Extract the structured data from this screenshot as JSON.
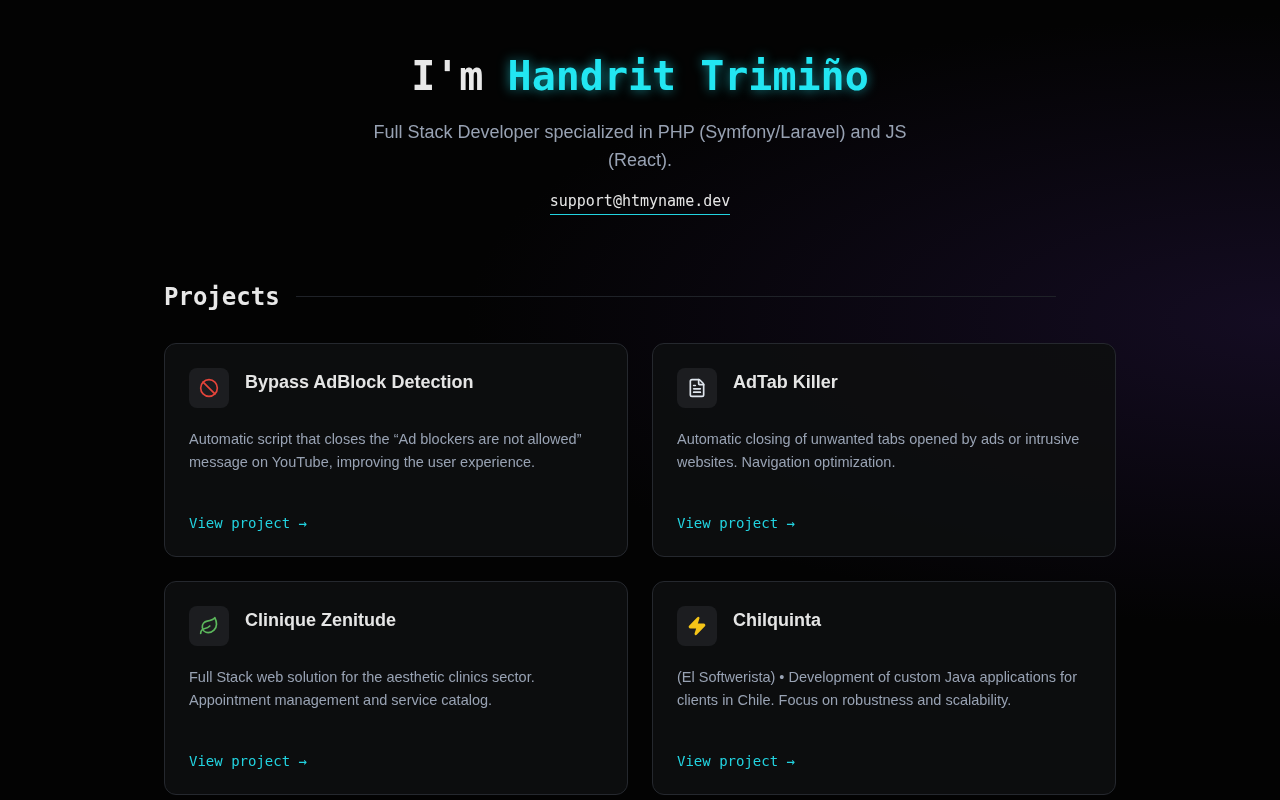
{
  "hero": {
    "greeting": "I'm",
    "name": "Handrit Trimiño",
    "tagline": "Full Stack Developer specialized in PHP (Symfony/Laravel) and JS (React).",
    "email": "support@htmyname.dev"
  },
  "projects": {
    "heading": "Projects",
    "items": [
      {
        "title": "Bypass AdBlock Detection",
        "description": "Automatic script that closes the “Ad blockers are not allowed” message on YouTube, improving the user experience.",
        "link": "View project →"
      },
      {
        "title": "AdTab Killer",
        "description": "Automatic closing of unwanted tabs opened by ads or intrusive websites. Navigation optimization.",
        "link": "View project →"
      },
      {
        "title": "Clinique Zenitude",
        "description": "Full Stack web solution for the aesthetic clinics sector. Appointment management and service catalog.",
        "link": "View project →"
      },
      {
        "title": "Chilquinta",
        "description": "(El Softwerista) • Development of custom Java applications for clients in Chile. Focus on robustness and scalability.",
        "link": "View project →"
      }
    ]
  }
}
